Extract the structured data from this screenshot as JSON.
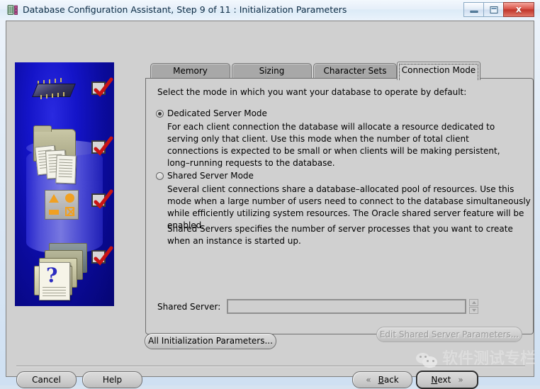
{
  "window": {
    "title": "Database Configuration Assistant, Step 9 of 11 : Initialization Parameters",
    "icon": "database-icon",
    "controls": {
      "minimize": "minimize-button",
      "maximize": "maximize-button",
      "close_glyph": "x"
    }
  },
  "tabs": [
    {
      "label": "Memory",
      "selected": false
    },
    {
      "label": "Sizing",
      "selected": false
    },
    {
      "label": "Character Sets",
      "selected": false
    },
    {
      "label": "Connection Mode",
      "selected": true
    }
  ],
  "panel": {
    "intro": "Select the mode in which you want your database to operate by default:",
    "options": [
      {
        "label": "Dedicated Server Mode",
        "selected": true,
        "description": "For each client connection the database will allocate a resource dedicated to serving only that client.  Use this mode when the number of total client connections is expected to be small or when clients will be making persistent, long–running requests to the database."
      },
      {
        "label": "Shared Server Mode",
        "selected": false,
        "description": "Several client connections share a database–allocated pool of resources.  Use this mode when a large number of users need to connect to the database simultaneously while efficiently utilizing system resources.  The Oracle shared server feature will be enabled."
      }
    ],
    "shared_servers_note": "Shared Servers specifies the number of server processes that you want to create when an instance is started up.",
    "shared_server_label": "Shared Server:",
    "shared_server_value": "",
    "edit_shared_button": "Edit Shared Server Parameters...",
    "edit_shared_enabled": false
  },
  "footer": {
    "all_init_params": "All Initialization Parameters...",
    "cancel": "Cancel",
    "help": "Help",
    "back": "Back",
    "back_chevron": "«",
    "next": "Next",
    "next_chevron": "»"
  },
  "watermark": {
    "text": "软件测试专栏",
    "logo": "wechat-logo"
  },
  "colors": {
    "panel_bg": "#d0d0d0",
    "tab_unselected": "#a8a8a8",
    "art_blue": "#1414c8",
    "check_red": "#cc1111",
    "title_text": "#0b2a43"
  }
}
